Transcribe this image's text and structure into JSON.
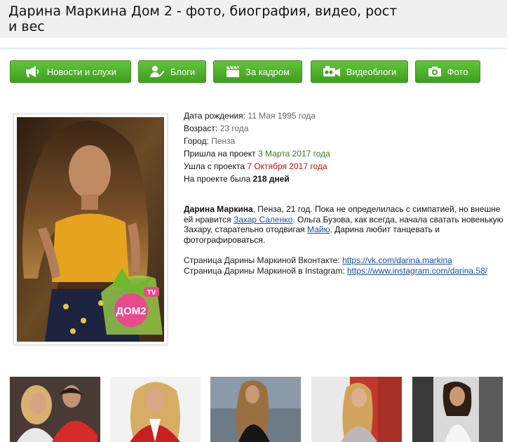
{
  "page": {
    "title": "Дарина Маркина Дом 2 - фото, биография, видео, рост и вес"
  },
  "nav": [
    {
      "label": "Новости и слухи",
      "icon": "megaphone-icon"
    },
    {
      "label": "Блоги",
      "icon": "user-pen-icon"
    },
    {
      "label": "За кадром",
      "icon": "clapperboard-icon"
    },
    {
      "label": "Видеоблоги",
      "icon": "video-camera-icon"
    },
    {
      "label": "Фото",
      "icon": "photo-camera-icon"
    }
  ],
  "profile": {
    "photo_logo_text": "ДОМ2",
    "photo_logo_tv": "TV",
    "birth_label": "Дата рождения:",
    "birth_value": "11 Мая 1995 года",
    "age_label": "Возраст:",
    "age_value": "23 года",
    "city_label": "Город:",
    "city_value": "Пенза",
    "joined_label": "Пришла на проект",
    "joined_value": "3 Марта 2017 года",
    "left_label": "Ушла с проекта",
    "left_value": "7 Октября 2017 года",
    "days_label": "На проекте была",
    "days_value": "218 дней"
  },
  "bio": {
    "name": "Дарина Маркина",
    "text1": ", Пенза, 21 год. Пока не определилась с симпатией, но внешне ей нравится ",
    "link1": "Захар Саленко",
    "text2": ". Ольга Бузова, как всегда, начала сватать новенькую Захару, старательно отодвигая ",
    "link2": "Майю",
    "text3": ". Дарина любит танцевать и фотографироваться."
  },
  "links": {
    "vk_label": "Страница Дарины Маркиной Вконтакте: ",
    "vk_url": "https://vk.com/darina.markina",
    "ig_label": "Страница Дарины Маркиной в Instagram: ",
    "ig_url": "https://www.instagram.com/darina.58/"
  },
  "colors": {
    "button_green": "#4fb22a",
    "date_green": "#3d7a1e",
    "date_red": "#c01010",
    "link_blue": "#1a4fa0"
  }
}
